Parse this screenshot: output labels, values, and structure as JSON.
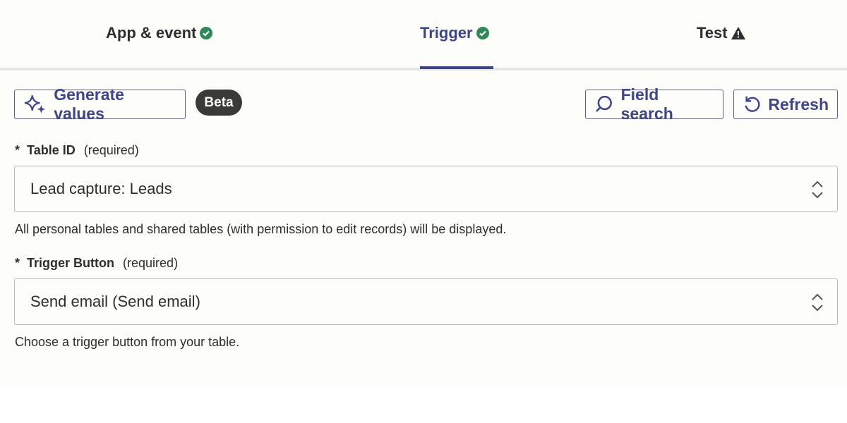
{
  "tabs": [
    {
      "label": "App & event",
      "status": "complete",
      "icon": "check-circle-icon"
    },
    {
      "label": "Trigger",
      "status": "complete",
      "icon": "check-circle-icon",
      "active": true
    },
    {
      "label": "Test",
      "status": "warning",
      "icon": "warning-triangle-icon"
    }
  ],
  "toolbar": {
    "generate_label": "Generate values",
    "beta_label": "Beta",
    "field_search_label": "Field search",
    "refresh_label": "Refresh"
  },
  "fields": [
    {
      "asterisk": "*",
      "label": "Table ID",
      "required": "(required)",
      "value": "Lead capture: Leads",
      "help": "All personal tables and shared tables (with permission to edit records) will be displayed."
    },
    {
      "asterisk": "*",
      "label": "Trigger Button",
      "required": "(required)",
      "value": "Send email (Send email)",
      "help": "Choose a trigger button from your table."
    }
  ],
  "colors": {
    "accent": "#3d4592",
    "success": "#2e8b57",
    "text": "#2d2e2e"
  }
}
